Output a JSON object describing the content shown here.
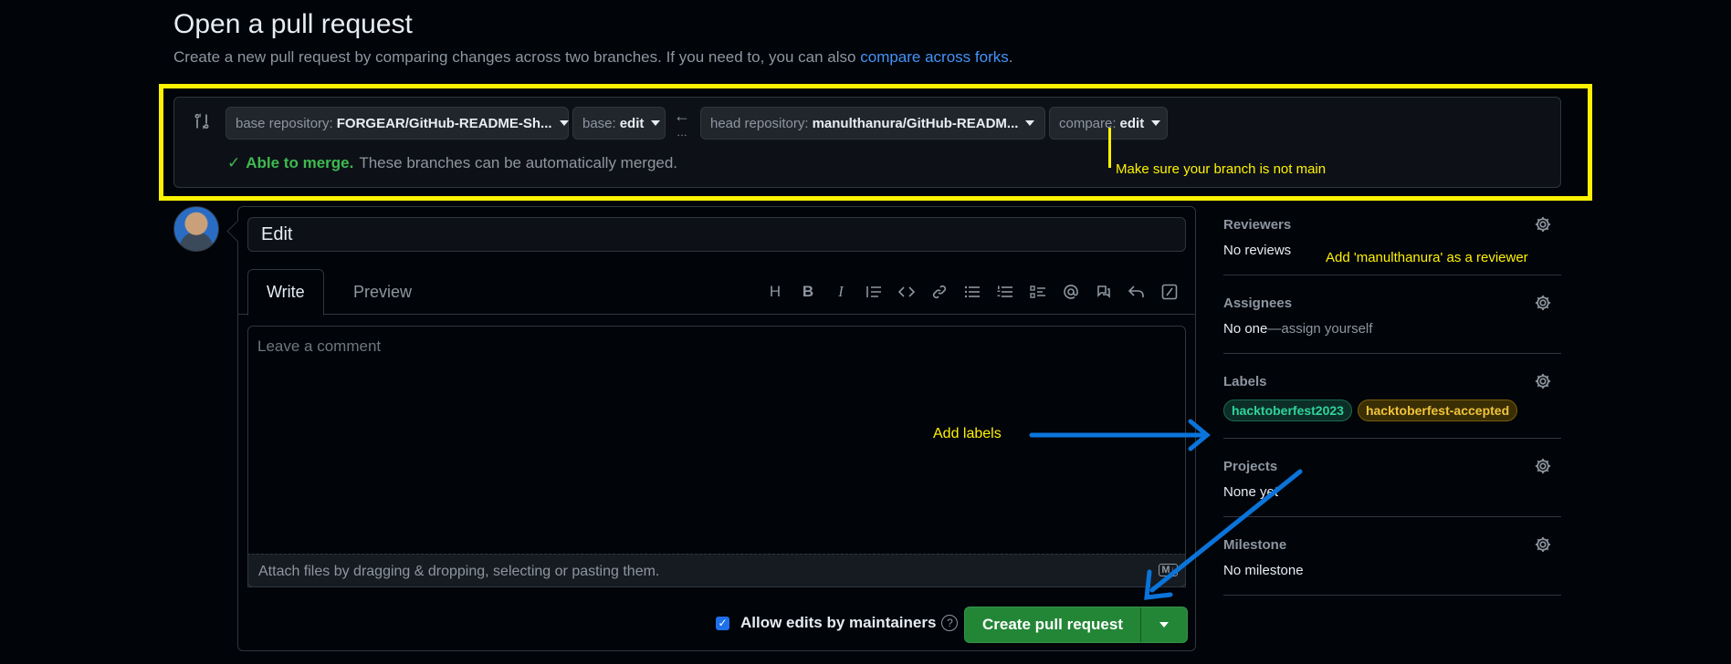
{
  "header": {
    "title": "Open a pull request",
    "subtitle": "Create a new pull request by comparing changes across two branches. If you need to, you can also",
    "subtitle_link": "compare across forks",
    "subtitle_end": "."
  },
  "compare": {
    "base_repo_label": "base repository:",
    "base_repo_value": "FORGEAR/GitHub-README-Sh...",
    "base_label": "base:",
    "base_value": "edit",
    "head_repo_label": "head repository:",
    "head_repo_value": "manulthanura/GitHub-READM...",
    "compare_label": "compare:",
    "compare_value": "edit",
    "merge_ok": "Able to merge.",
    "merge_text": "These branches can be automatically merged."
  },
  "annotations": {
    "branch_note": "Make sure your branch is not main",
    "reviewer_note": "Add 'manulthanura' as a reviewer",
    "labels_note": "Add labels",
    "color": "#fff200",
    "arrow_color": "#0a74da"
  },
  "form": {
    "title_value": "Edit",
    "tab_write": "Write",
    "tab_preview": "Preview",
    "comment_placeholder": "Leave a comment",
    "attach_text": "Attach files by dragging & dropping, selecting or pasting them.",
    "md_badge": "M↓",
    "allow_edits": "Allow edits by maintainers",
    "create_button": "Create pull request",
    "toolbar": [
      "heading-icon",
      "bold-icon",
      "italic-icon",
      "quote-icon",
      "code-icon",
      "link-icon",
      "unordered-list-icon",
      "ordered-list-icon",
      "task-list-icon",
      "mention-icon",
      "reference-icon",
      "reply-icon",
      "slash-command-icon"
    ]
  },
  "sidebar": {
    "reviewers": {
      "title": "Reviewers",
      "value": "No reviews"
    },
    "assignees": {
      "title": "Assignees",
      "value": "No one",
      "action": "—assign yourself"
    },
    "labels": {
      "title": "Labels",
      "items": [
        "hacktoberfest2023",
        "hacktoberfest-accepted"
      ]
    },
    "projects": {
      "title": "Projects",
      "value": "None yet"
    },
    "milestone": {
      "title": "Milestone",
      "value": "No milestone"
    }
  }
}
